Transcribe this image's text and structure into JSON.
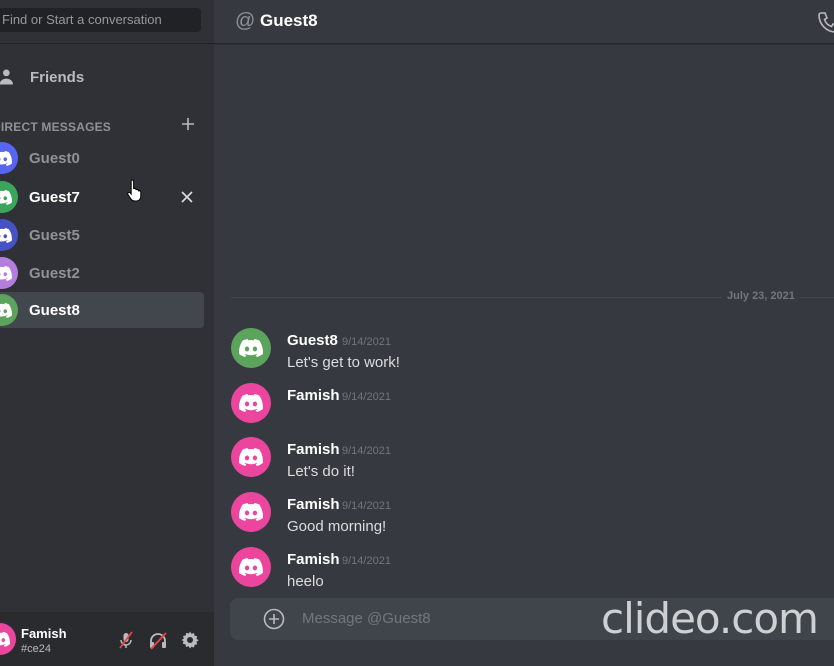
{
  "sidebar": {
    "search_placeholder": "Find or Start a conversation",
    "friends_label": "Friends",
    "dm_header": "DIRECT MESSAGES",
    "dms": [
      {
        "name": "Guest0",
        "color": "#5865f2",
        "bright": false
      },
      {
        "name": "Guest7",
        "color": "#3ba55c",
        "bright": true
      },
      {
        "name": "Guest5",
        "color": "#4752c4",
        "bright": false
      },
      {
        "name": "Guest2",
        "color": "#b57edc",
        "bright": false
      },
      {
        "name": "Guest8",
        "color": "#5ca35c",
        "bright": true
      }
    ]
  },
  "user": {
    "name": "Famish",
    "tag": "#ce24",
    "avatar_color": "#eb459e"
  },
  "header": {
    "at_symbol": "@",
    "title": "Guest8"
  },
  "divider": {
    "date": "July 23, 2021"
  },
  "messages": [
    {
      "author": "Guest8",
      "time": "9/14/2021",
      "text": "Let's get to work!",
      "color": "#5ca35c"
    },
    {
      "author": "Famish",
      "time": "9/14/2021",
      "text": "",
      "color": "#eb459e"
    },
    {
      "author": "Famish",
      "time": "9/14/2021",
      "text": "Let's do it!",
      "color": "#eb459e"
    },
    {
      "author": "Famish",
      "time": "9/14/2021",
      "text": "Good morning!",
      "color": "#eb459e"
    },
    {
      "author": "Famish",
      "time": "9/14/2021",
      "text": "heelo",
      "color": "#eb459e"
    }
  ],
  "composer": {
    "placeholder": "Message @Guest8"
  },
  "watermark": "clideo.com",
  "icons": {
    "avatar": "discord-logo-icon",
    "friends": "person-wave-icon",
    "add_dm": "plus-icon",
    "close_dm": "close-icon",
    "mute": "microphone-muted-icon",
    "deafen": "headphones-deafened-icon",
    "settings": "gear-icon",
    "call": "phone-icon",
    "attach": "plus-circle-icon",
    "cursor": "hand-pointer-icon"
  }
}
